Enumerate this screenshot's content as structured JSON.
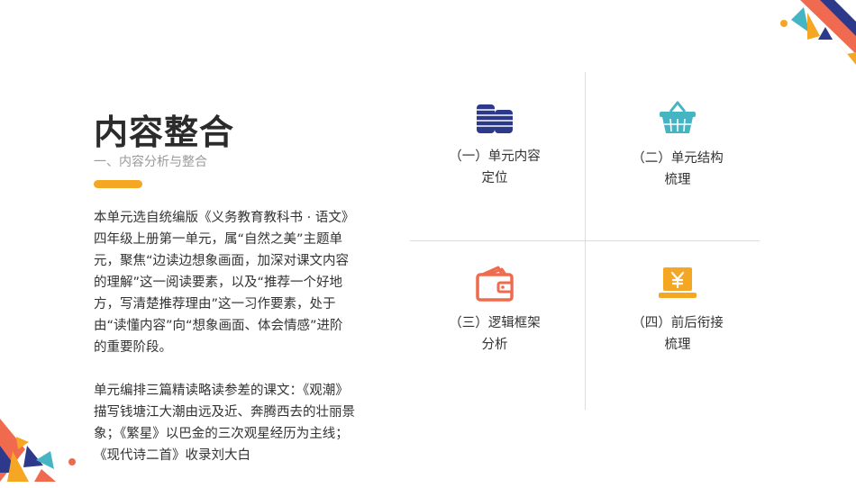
{
  "header": {
    "title": "内容整合",
    "subtitle": "一、内容分析与整合"
  },
  "body": {
    "paragraphs": [
      "本单元选自统编版《义务教育教科书 · 语文》四年级上册第一单元，属“自然之美”主题单元，聚焦“边读边想象画面，加深对课文内容的理解”这一阅读要素，以及“推荐一个好地方，写清楚推荐理由”这一习作要素，处于由“读懂内容”向“想象画面、体会情感”进阶的重要阶段。",
      "单元编排三篇精读略读参差的课文：《观潮》描写钱塘江大潮由远及近、奔腾西去的壮丽景象；《繁星》以巴金的三次观星经历为主线；《现代诗二首》收录刘大白"
    ]
  },
  "grid": {
    "items": [
      {
        "line1": "（一）单元内容",
        "line2": "定位",
        "icon": "coin-stack-icon"
      },
      {
        "line1": "（二）单元结构",
        "line2": "梳理",
        "icon": "basket-icon"
      },
      {
        "line1": "（三）逻辑框架",
        "line2": "分析",
        "icon": "wallet-icon"
      },
      {
        "line1": "（四）前后衔接",
        "line2": "梳理",
        "icon": "yen-screen-icon"
      }
    ]
  },
  "colors": {
    "accent": "#f5a623",
    "navy": "#2d3a8c",
    "teal": "#45b5c4",
    "coral": "#f06a4f",
    "orange": "#f5a623"
  }
}
